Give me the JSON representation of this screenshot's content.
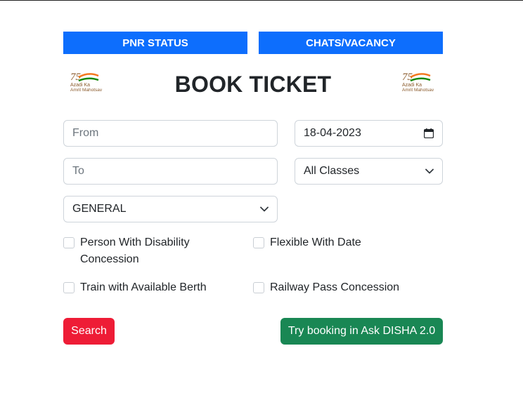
{
  "tabs": {
    "pnr_status": "PNR STATUS",
    "chats_vacancy": "CHATS/VACANCY"
  },
  "logo": {
    "line1": "Azadi Ka",
    "line2": "Amrit Mahotsav",
    "icon": "azadi-ka-amrit-mahotsav-logo"
  },
  "page_title": "BOOK TICKET",
  "form": {
    "from_placeholder": "From",
    "to_placeholder": "To",
    "date_value": "18-04-2023",
    "class_selected": "All Classes",
    "quota_selected": "GENERAL"
  },
  "checkboxes": {
    "disability_line1": "Person With Disability",
    "disability_line2": "Concession",
    "flexible_date": "Flexible With Date",
    "available_berth": "Train with Available Berth",
    "railway_pass": "Railway Pass Concession"
  },
  "buttons": {
    "search": "Search",
    "disha": "Try booking in Ask DISHA 2.0"
  },
  "colors": {
    "primary_blue": "#0d6efd",
    "search_red": "#ee1c36",
    "disha_green": "#198754"
  }
}
